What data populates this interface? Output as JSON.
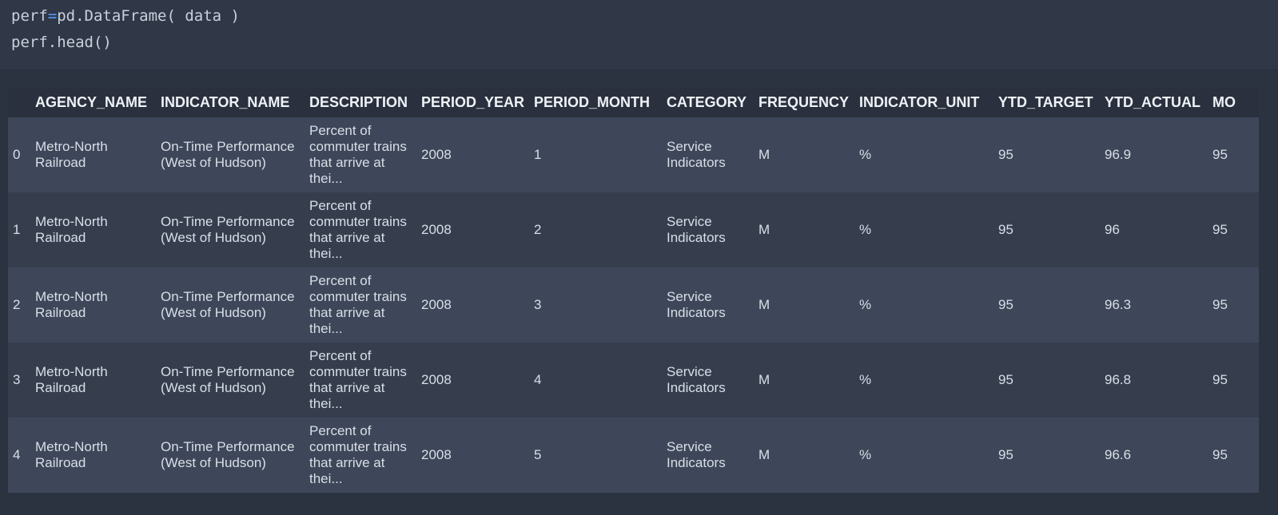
{
  "code": {
    "line1_prefix": "perf",
    "line1_op": "=",
    "line1_suffix": "pd.DataFrame( data )",
    "line2": "perf.head()"
  },
  "table": {
    "headers": [
      "",
      "AGENCY_NAME",
      "INDICATOR_NAME",
      "DESCRIPTION",
      "PERIOD_YEAR",
      "PERIOD_MONTH",
      "CATEGORY",
      "FREQUENCY",
      "INDICATOR_UNIT",
      "YTD_TARGET",
      "YTD_ACTUAL",
      "MO"
    ],
    "rows": [
      [
        "0",
        "Metro-North Railroad",
        "On-Time Performance (West of Hudson)",
        "Percent of commuter trains that arrive at thei...",
        "2008",
        "1",
        "Service Indicators",
        "M",
        "%",
        "95",
        "96.9",
        "95"
      ],
      [
        "1",
        "Metro-North Railroad",
        "On-Time Performance (West of Hudson)",
        "Percent of commuter trains that arrive at thei...",
        "2008",
        "2",
        "Service Indicators",
        "M",
        "%",
        "95",
        "96",
        "95"
      ],
      [
        "2",
        "Metro-North Railroad",
        "On-Time Performance (West of Hudson)",
        "Percent of commuter trains that arrive at thei...",
        "2008",
        "3",
        "Service Indicators",
        "M",
        "%",
        "95",
        "96.3",
        "95"
      ],
      [
        "3",
        "Metro-North Railroad",
        "On-Time Performance (West of Hudson)",
        "Percent of commuter trains that arrive at thei...",
        "2008",
        "4",
        "Service Indicators",
        "M",
        "%",
        "95",
        "96.8",
        "95"
      ],
      [
        "4",
        "Metro-North Railroad",
        "On-Time Performance (West of Hudson)",
        "Percent of commuter trains that arrive at thei...",
        "2008",
        "5",
        "Service Indicators",
        "M",
        "%",
        "95",
        "96.6",
        "95"
      ]
    ]
  },
  "colors": {
    "background": "#2b3240",
    "code_cell": "#303848",
    "header_row": "#2a303d",
    "row_odd": "#3e4759",
    "row_even": "#363e4e",
    "operator": "#4ea1ff"
  }
}
